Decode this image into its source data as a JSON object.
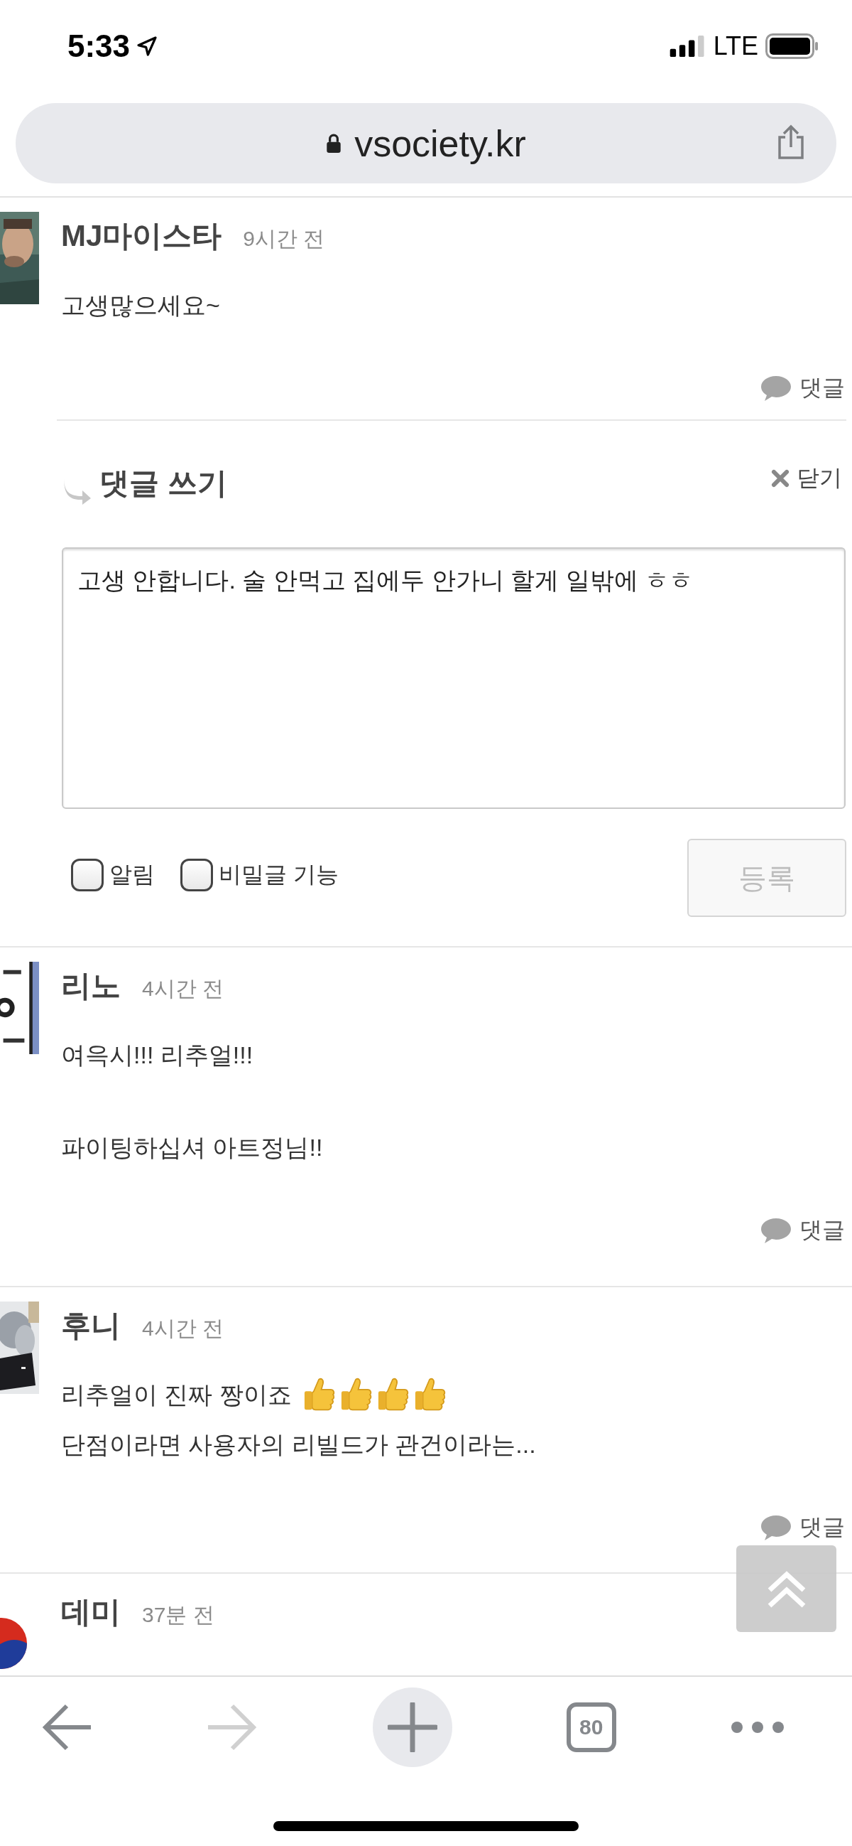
{
  "status_bar": {
    "time": "5:33",
    "network": "LTE"
  },
  "address_bar": {
    "url": "vsociety.kr"
  },
  "comments": [
    {
      "author": "MJ마이스타",
      "time": "9시간 전",
      "paragraphs": [
        [
          {
            "text": "고생많으세요~"
          }
        ]
      ],
      "reply_label": "댓글"
    },
    {
      "author": "리노",
      "time": "4시간 전",
      "paragraphs": [
        [
          {
            "text": "여윽시!!! 리추얼!!!"
          }
        ],
        [
          {
            "text": "파이팅하십셔 아트정님!!"
          }
        ]
      ],
      "reply_label": "댓글"
    },
    {
      "author": "후니",
      "time": "4시간 전",
      "paragraphs": [
        [
          {
            "text": "리추얼이 진짜 짱이죠",
            "emojis": [
              {
                "kind": "thumbs-up"
              },
              {
                "kind": "thumbs-up"
              },
              {
                "kind": "thumbs-up"
              },
              {
                "kind": "thumbs-up"
              }
            ]
          },
          {
            "text": "단점이라면 사용자의 리빌드가 관건이라는..."
          }
        ]
      ],
      "reply_label": "댓글"
    },
    {
      "author": "데미",
      "time": "37분 전"
    }
  ],
  "reply_form": {
    "title": "댓글 쓰기",
    "close_label": "닫기",
    "value": "고생 안합니다. 술 안먹고 집에두 안가니 할게 일밖에 ㅎㅎ",
    "options": [
      {
        "label": "알림",
        "checked": false
      },
      {
        "label": "비밀글 기능",
        "checked": false
      }
    ],
    "submit": {
      "label": "등록",
      "disabled": true
    }
  },
  "toolbar": {
    "back_disabled": false,
    "forward_disabled": true,
    "tab_count": "80"
  }
}
